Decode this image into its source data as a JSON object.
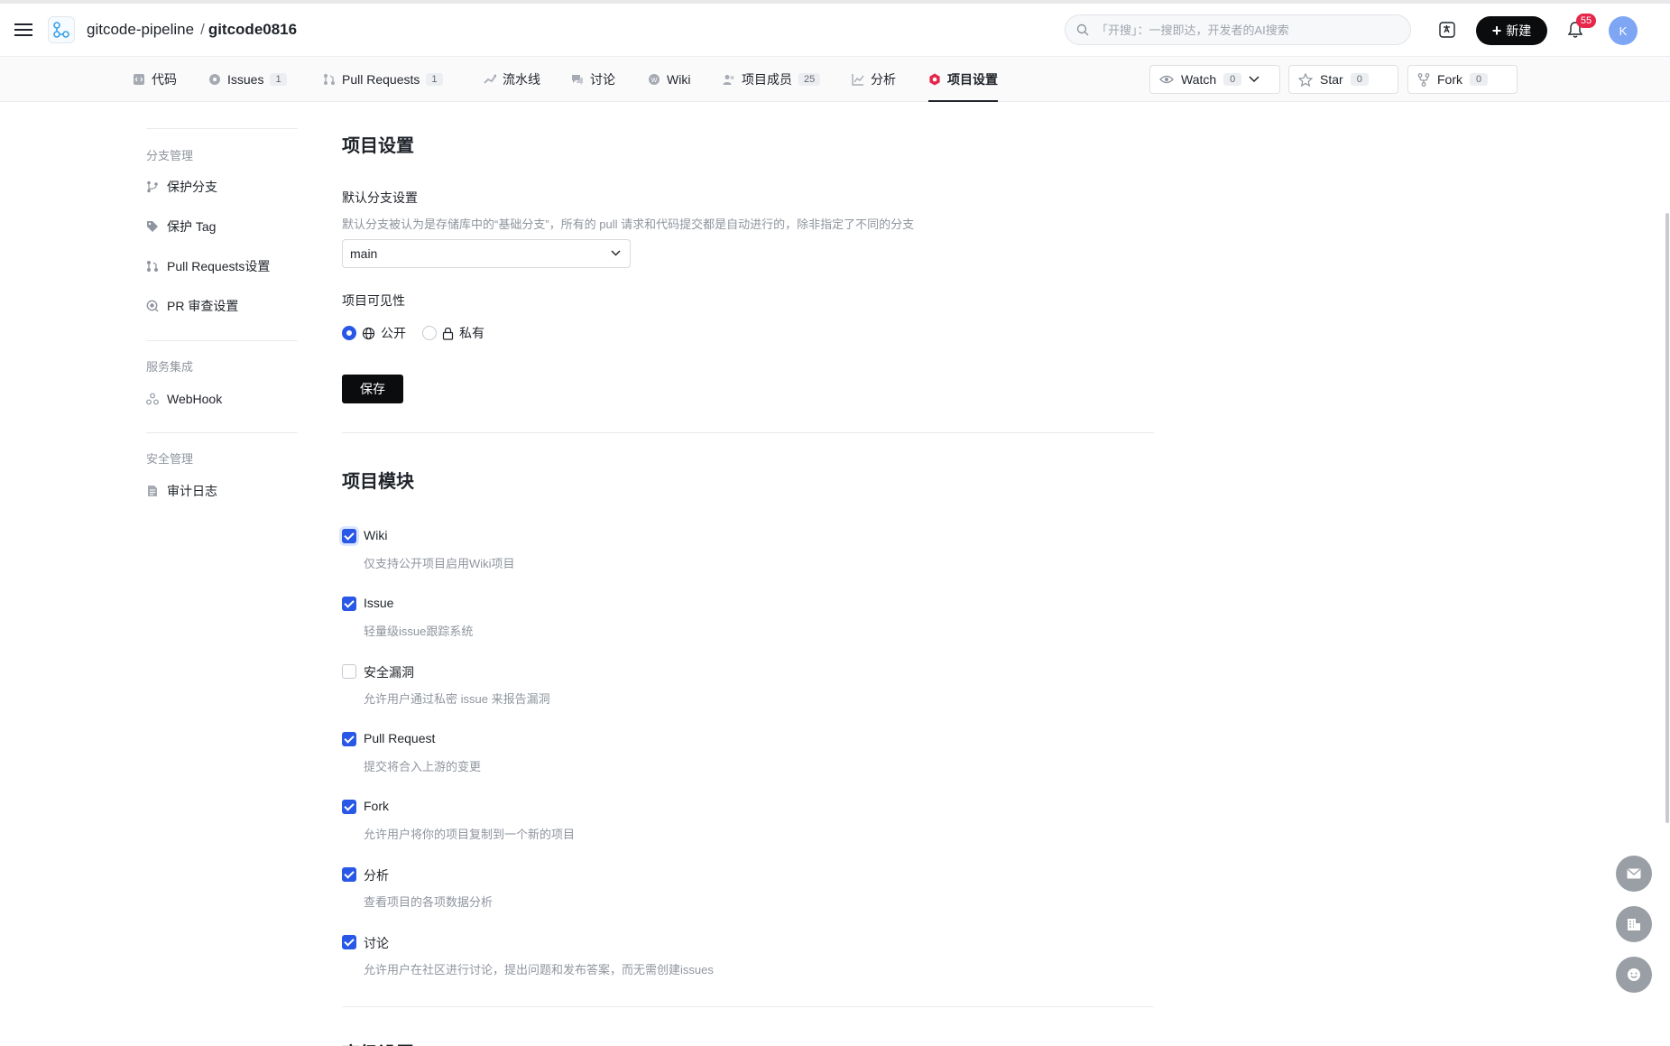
{
  "header": {
    "repo_owner": "gitcode-pipeline",
    "repo_sep": "/",
    "repo_name": "gitcode0816",
    "search_placeholder": "「开搜」：一搜即达，开发者的AI搜索",
    "new_label": "新建",
    "notification_count": "55",
    "avatar_initial": "K"
  },
  "tabs": [
    {
      "label": "代码",
      "icon": "code-icon"
    },
    {
      "label": "Issues",
      "count": "1",
      "icon": "issue-icon"
    },
    {
      "label": "Pull Requests",
      "count": "1",
      "icon": "pull-request-icon"
    },
    {
      "label": "流水线",
      "icon": "pipeline-icon"
    },
    {
      "label": "讨论",
      "icon": "discussion-icon"
    },
    {
      "label": "Wiki",
      "icon": "wiki-icon"
    },
    {
      "label": "项目成员",
      "count": "25",
      "icon": "members-icon"
    },
    {
      "label": "分析",
      "icon": "chart-icon"
    },
    {
      "label": "项目设置",
      "icon": "settings-icon",
      "active": true
    }
  ],
  "repo_actions": {
    "watch_label": "Watch",
    "watch_count": "0",
    "star_label": "Star",
    "star_count": "0",
    "fork_label": "Fork",
    "fork_count": "0"
  },
  "sidebar": {
    "groups": [
      {
        "title": "分支管理",
        "items": [
          {
            "label": "保护分支",
            "icon": "branch-icon"
          },
          {
            "label": "保护 Tag",
            "icon": "tag-icon"
          },
          {
            "label": "Pull Requests设置",
            "icon": "pull-request-icon"
          },
          {
            "label": "PR 审查设置",
            "icon": "review-icon"
          }
        ]
      },
      {
        "title": "服务集成",
        "items": [
          {
            "label": "WebHook",
            "icon": "webhook-icon"
          }
        ]
      },
      {
        "title": "安全管理",
        "items": [
          {
            "label": "审计日志",
            "icon": "document-icon"
          }
        ]
      }
    ]
  },
  "settings": {
    "title": "项目设置",
    "default_branch_label": "默认分支设置",
    "default_branch_hint": "默认分支被认为是存储库中的“基础分支”，所有的 pull 请求和代码提交都是自动进行的，除非指定了不同的分支",
    "default_branch_value": "main",
    "visibility_label": "项目可见性",
    "visibility_public": "公开",
    "visibility_private": "私有",
    "visibility_selected": "公开",
    "save_label": "保存"
  },
  "modules": {
    "title": "项目模块",
    "items": [
      {
        "name": "Wiki",
        "desc": "仅支持公开项目启用Wiki项目",
        "checked": true
      },
      {
        "name": "Issue",
        "desc": "轻量级issue跟踪系统",
        "checked": true
      },
      {
        "name": "安全漏洞",
        "desc": "允许用户通过私密 issue 来报告漏洞",
        "checked": false
      },
      {
        "name": "Pull Request",
        "desc": "提交将合入上游的变更",
        "checked": true
      },
      {
        "name": "Fork",
        "desc": "允许用户将你的项目复制到一个新的项目",
        "checked": true
      },
      {
        "name": "分析",
        "desc": "查看项目的各项数据分析",
        "checked": true
      },
      {
        "name": "讨论",
        "desc": "允许用户在社区进行讨论，提出问题和发布答案，而无需创建issues",
        "checked": true
      }
    ]
  },
  "next_section_title": "高级设置",
  "colors": {
    "accent": "#2a58e6",
    "primary_button": "#0b0c0e",
    "active_tab_icon": "#e6264a"
  }
}
